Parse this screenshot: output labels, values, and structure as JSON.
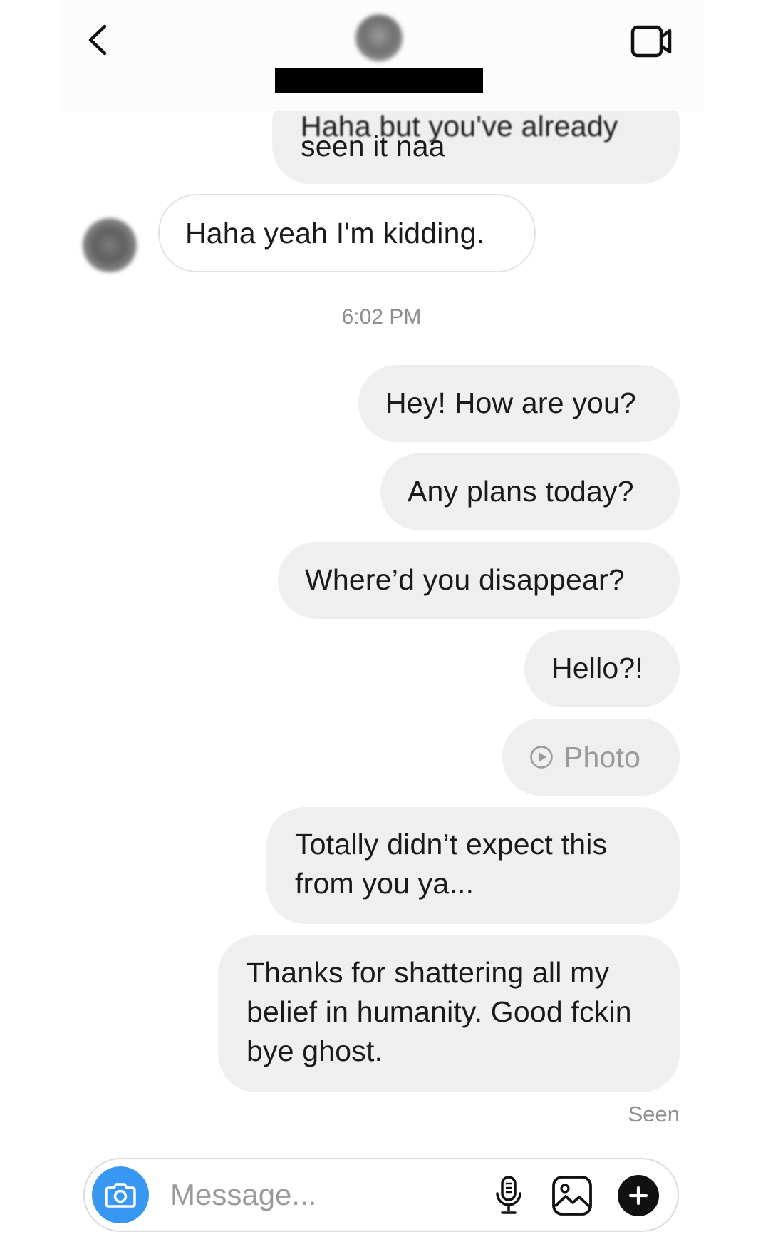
{
  "header": {
    "back_icon": "chevron-left-icon",
    "video_icon": "video-camera-icon"
  },
  "messages": {
    "partial_top": {
      "cut_text": "Haha but you've already",
      "text": "seen it naa"
    },
    "received": "Haha yeah I'm kidding.",
    "timestamp": "6:02 PM",
    "sent": [
      "Hey! How are you?",
      "Any plans today?",
      "Where’d you disappear?",
      "Hello?!"
    ],
    "photo_label": "Photo",
    "long_1": "Totally didn’t expect this from you ya...",
    "long_2": "Thanks for shattering all my belief in humanity. Good fckin bye ghost.",
    "seen": "Seen"
  },
  "composer": {
    "placeholder": "Message...",
    "accent": "#3897f0",
    "icons": [
      "camera-icon",
      "microphone-icon",
      "gallery-icon",
      "plus-icon"
    ]
  }
}
